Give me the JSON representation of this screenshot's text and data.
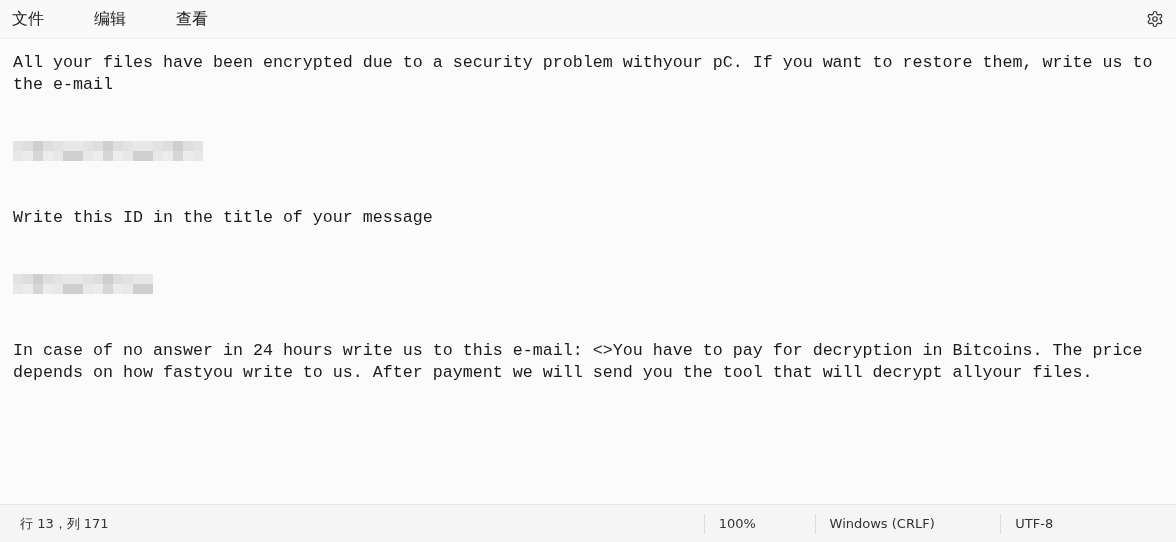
{
  "menu": [
    "文件",
    "编辑",
    "查看"
  ],
  "document": [
    {
      "kind": "text",
      "text": "All your files have been encrypted due to a security problem withyour pC. If you want to restore them, write us to the e-mail"
    },
    {
      "kind": "blank"
    },
    {
      "kind": "blank"
    },
    {
      "kind": "redacted-long"
    },
    {
      "kind": "blank"
    },
    {
      "kind": "blank"
    },
    {
      "kind": "text",
      "text": "Write this ID in the title of your message"
    },
    {
      "kind": "blank"
    },
    {
      "kind": "blank"
    },
    {
      "kind": "redacted-short"
    },
    {
      "kind": "blank"
    },
    {
      "kind": "blank"
    },
    {
      "kind": "text",
      "text": "In case of no answer in 24 hours write us to this e-mail: <>You have to pay for decryption in Bitcoins. The price depends on how fastyou write to us. After payment we will send you the tool that will decrypt allyour files."
    }
  ],
  "status_bar": {
    "position": "行 13，列 171",
    "zoom": "100%",
    "line_ending": "Windows (CRLF)",
    "encoding": "UTF-8"
  }
}
